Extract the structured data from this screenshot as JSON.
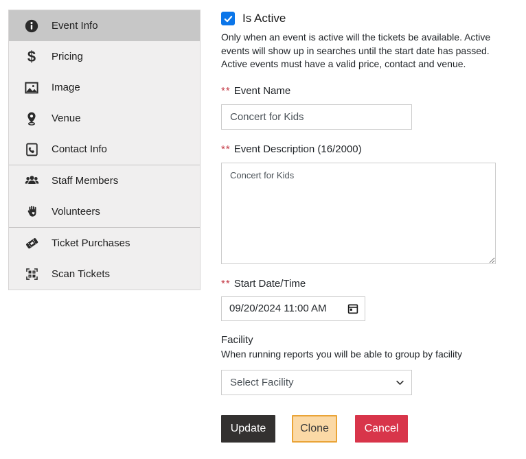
{
  "sidebar": {
    "groups": [
      {
        "items": [
          {
            "label": "Event Info",
            "icon": "info-icon",
            "active": true
          },
          {
            "label": "Pricing",
            "icon": "dollar-icon",
            "active": false
          },
          {
            "label": "Image",
            "icon": "image-icon",
            "active": false
          },
          {
            "label": "Venue",
            "icon": "location-pin-icon",
            "active": false
          },
          {
            "label": "Contact Info",
            "icon": "contact-book-icon",
            "active": false
          }
        ]
      },
      {
        "items": [
          {
            "label": "Staff Members",
            "icon": "people-icon",
            "active": false
          },
          {
            "label": "Volunteers",
            "icon": "hand-heart-icon",
            "active": false
          }
        ]
      },
      {
        "items": [
          {
            "label": "Ticket Purchases",
            "icon": "ticket-icon",
            "active": false
          },
          {
            "label": "Scan Tickets",
            "icon": "qr-code-icon",
            "active": false
          }
        ]
      }
    ]
  },
  "icons": {
    "dollar_glyph": "$"
  },
  "form": {
    "is_active": {
      "label": "Is Active",
      "checked": true,
      "help": "Only when an event is active will the tickets be available. Active events will show up in searches until the start date has passed. Active events must have a valid price, contact and venue."
    },
    "event_name": {
      "required_marker": "**",
      "label": "Event Name",
      "value": "Concert for Kids"
    },
    "event_description": {
      "required_marker": "**",
      "label": "Event Description (16/2000)",
      "value": "Concert for Kids"
    },
    "start_datetime": {
      "required_marker": "**",
      "label": "Start Date/Time",
      "value": "09/20/2024 11:00 AM"
    },
    "facility": {
      "label": "Facility",
      "help": "When running reports you will be able to group by facility",
      "selected_option": "Select Facility"
    },
    "buttons": {
      "update": "Update",
      "clone": "Clone",
      "cancel": "Cancel"
    }
  },
  "colors": {
    "checkbox_blue": "#0b76e9",
    "required_red": "#c43a46",
    "sidebar_selected": "#c7c7c7",
    "sidebar_bg": "#f0efef",
    "update_bg": "#333130",
    "clone_bg": "#fbd9a6",
    "clone_border": "#eaa437",
    "cancel_bg": "#d8354a"
  }
}
